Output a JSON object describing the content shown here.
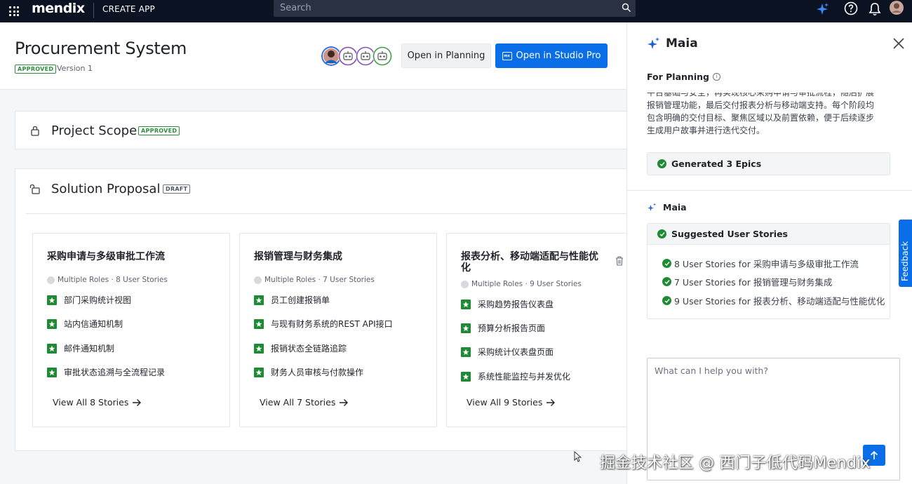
{
  "topbar": {
    "logo": "mendix",
    "section": "CREATE APP",
    "search_placeholder": "Search"
  },
  "header": {
    "title": "Procurement System",
    "status_badge": "APPROVED",
    "version": "Version 1",
    "open_planning": "Open in Planning",
    "open_studio": "Open in Studio Pro",
    "studio_icon_text": "mx"
  },
  "project_scope": {
    "title": "Project Scope",
    "badge": "APPROVED"
  },
  "solution_proposal": {
    "title": "Solution Proposal",
    "badge": "DRAFT",
    "epics": [
      {
        "title": "采购申请与多级审批工作流",
        "meta": "Multiple Roles · 8 User Stories",
        "stories": [
          "部门采购统计视图",
          "站内信通知机制",
          "邮件通知机制",
          "审批状态追溯与全流程记录"
        ],
        "view_all": "View All 8 Stories"
      },
      {
        "title": "报销管理与财务集成",
        "meta": "Multiple Roles · 7 User Stories",
        "stories": [
          "员工创建报销单",
          "与现有财务系统的REST API接口",
          "报销状态全链路追踪",
          "财务人员审核与付款操作"
        ],
        "view_all": "View All 7 Stories"
      },
      {
        "title": "报表分析、移动端适配与性能优化",
        "meta": "Multiple Roles · 9 User Stories",
        "stories": [
          "采购趋势报告仪表盘",
          "预算分析报告页面",
          "采购统计仪表盘页面",
          "系统性能监控与并发优化"
        ],
        "view_all": "View All 9 Stories"
      }
    ]
  },
  "maia": {
    "title": "Maia",
    "for_planning": "For Planning",
    "info_glyph": "i",
    "paragraph": "平台基础与安全，再实现核心采购申请与审批流程，随后扩展报销管理功能，最后交付报表分析与移动端支持。每个阶段均包含明确的交付目标、聚焦区域以及前置依赖，便于后续逐步生成用户故事并进行迭代交付。",
    "generated": "Generated 3 Epics",
    "maia_label": "Maia",
    "suggested_title": "Suggested User Stories",
    "suggestions": [
      "8 User Stories for 采购申请与多级审批工作流",
      "7 User Stories for 报销管理与财务集成",
      "9 User Stories for 报表分析、移动端适配与性能优化"
    ],
    "chat_placeholder": "What can I help you with?"
  },
  "feedback": "Feedback",
  "watermark": "掘金技术社区 @ 西门子低代码Mendix",
  "colors": {
    "topbar": "#0b1222",
    "primary": "#0a6ee8",
    "approved": "#2e8b3e",
    "story_star": "#1f8a34"
  }
}
